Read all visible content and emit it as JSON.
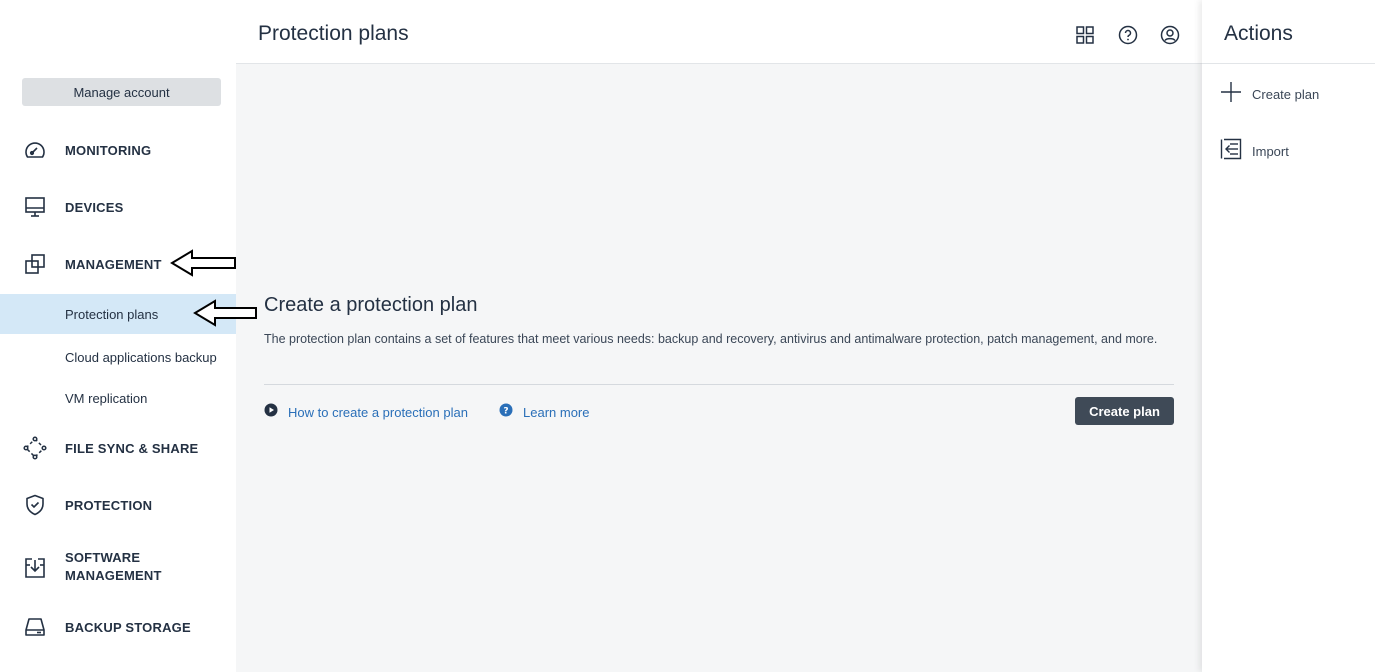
{
  "sidebar": {
    "manage_account": "Manage account",
    "items": [
      {
        "label": "MONITORING",
        "icon": "gauge-icon"
      },
      {
        "label": "DEVICES",
        "icon": "monitor-icon"
      },
      {
        "label": "MANAGEMENT",
        "icon": "management-icon"
      },
      {
        "label": "FILE SYNC & SHARE",
        "icon": "file-sync-icon"
      },
      {
        "label": "PROTECTION",
        "icon": "shield-check-icon"
      },
      {
        "label": "SOFTWARE MANAGEMENT",
        "line1": "SOFTWARE",
        "line2": "MANAGEMENT",
        "icon": "software-download-icon"
      },
      {
        "label": "BACKUP STORAGE",
        "icon": "storage-drive-icon"
      }
    ],
    "sub_items": [
      {
        "label": "Protection plans",
        "active": true
      },
      {
        "label": "Cloud applications backup",
        "active": false
      },
      {
        "label": "VM replication",
        "active": false
      }
    ]
  },
  "header": {
    "title": "Protection plans",
    "icons": [
      "apps-grid-icon",
      "help-icon",
      "user-account-icon"
    ]
  },
  "empty_state": {
    "title": "Create a protection plan",
    "description": "The protection plan contains a set of features that meet various needs: backup and recovery, antivirus and antimalware protection, patch management, and more.",
    "link_video": "How to create a protection plan",
    "link_learn": "Learn more",
    "create_button": "Create plan"
  },
  "actions_panel": {
    "title": "Actions",
    "items": [
      {
        "label": "Create plan",
        "icon": "plus-icon"
      },
      {
        "label": "Import",
        "icon": "import-icon"
      }
    ]
  },
  "colors": {
    "active_sub_bg": "#d4e8f7",
    "link": "#2a6fb8",
    "primary_button": "#3f4a57",
    "main_bg": "#f5f6f7"
  }
}
